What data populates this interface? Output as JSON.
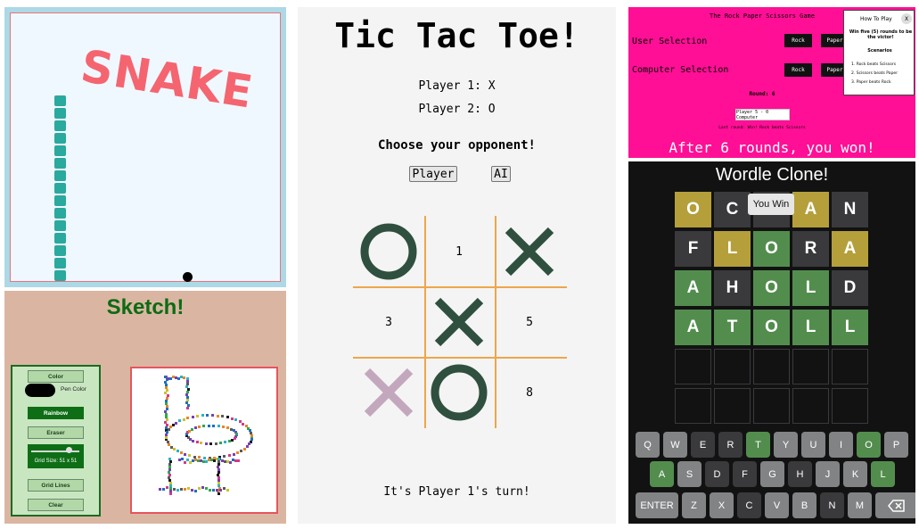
{
  "snake": {
    "title": "SNAKE"
  },
  "sketch": {
    "title": "Sketch!",
    "color_label": "Color",
    "pen_color_label": "Pen Color",
    "rainbow_label": "Rainbow",
    "eraser_label": "Eraser",
    "grid_size": "Grid Size: 51 x 51",
    "grid_lines_label": "Grid Lines",
    "clear_label": "Clear"
  },
  "ttt": {
    "title": "Tic Tac Toe!",
    "player1": "Player 1: X",
    "player2": "Player 2: O",
    "choose": "Choose your opponent!",
    "btn_player": "Player",
    "btn_ai": "AI",
    "cells": [
      "O",
      "1",
      "X",
      "3",
      "X",
      "5",
      "X",
      "O",
      "8"
    ],
    "status": "It's Player 1's turn!",
    "colors": {
      "mark": "#2f4f3f",
      "faded_x": "#c3a8bd",
      "grid": "#eea64a"
    }
  },
  "rps": {
    "title": "The Rock Paper Scissors Game",
    "user_label": "User Selection",
    "computer_label": "Computer Selection",
    "rock": "Rock",
    "paper": "Paper",
    "round": "Round: 6",
    "result": "Player 5 - 0 Computer",
    "history": "Last round: Win! Rock beats Scissors",
    "final": "After 6 rounds, you won!",
    "help": {
      "title": "How To Play",
      "close": "X",
      "text": "Win five (5) rounds to be the victor!",
      "scenarios": "Scenarios",
      "rules": [
        "1. Rock beats Scissors",
        "2. Scissors beats Paper",
        "3. Paper beats Rock"
      ]
    }
  },
  "wordle": {
    "title": "Wordle Clone!",
    "toast": "You Win",
    "rows": [
      {
        "letters": [
          "O",
          "C",
          "E",
          "A",
          "N"
        ],
        "states": [
          "present",
          "absent",
          "absent",
          "present",
          "absent"
        ]
      },
      {
        "letters": [
          "F",
          "L",
          "O",
          "R",
          "A"
        ],
        "states": [
          "absent",
          "present",
          "correct",
          "absent",
          "present"
        ]
      },
      {
        "letters": [
          "A",
          "H",
          "O",
          "L",
          "D"
        ],
        "states": [
          "correct",
          "absent",
          "correct",
          "correct",
          "absent"
        ]
      },
      {
        "letters": [
          "A",
          "T",
          "O",
          "L",
          "L"
        ],
        "states": [
          "correct",
          "correct",
          "correct",
          "correct",
          "correct"
        ]
      },
      {
        "letters": [
          "",
          "",
          "",
          "",
          ""
        ],
        "states": [
          "empty",
          "empty",
          "empty",
          "empty",
          "empty"
        ]
      },
      {
        "letters": [
          "",
          "",
          "",
          "",
          ""
        ],
        "states": [
          "empty",
          "empty",
          "empty",
          "empty",
          "empty"
        ]
      }
    ],
    "keyboard": [
      [
        [
          "Q",
          "used"
        ],
        [
          "W",
          "used"
        ],
        [
          "E",
          "absent"
        ],
        [
          "R",
          "absent"
        ],
        [
          "T",
          "correct"
        ],
        [
          "Y",
          "used"
        ],
        [
          "U",
          "used"
        ],
        [
          "I",
          "used"
        ],
        [
          "O",
          "correct"
        ],
        [
          "P",
          "used"
        ]
      ],
      [
        [
          "A",
          "correct"
        ],
        [
          "S",
          "used"
        ],
        [
          "D",
          "absent"
        ],
        [
          "F",
          "absent"
        ],
        [
          "G",
          "used"
        ],
        [
          "H",
          "absent"
        ],
        [
          "J",
          "used"
        ],
        [
          "K",
          "used"
        ],
        [
          "L",
          "correct"
        ]
      ],
      [
        [
          "ENTER",
          "used"
        ],
        [
          "Z",
          "used"
        ],
        [
          "X",
          "used"
        ],
        [
          "C",
          "absent"
        ],
        [
          "V",
          "used"
        ],
        [
          "B",
          "used"
        ],
        [
          "N",
          "absent"
        ],
        [
          "M",
          "used"
        ],
        [
          "backspace-icon",
          "used"
        ]
      ]
    ],
    "colors": {
      "correct": "#538d4e",
      "present": "#b59f3b",
      "absent": "#3a3a3c",
      "used": "#818384",
      "key_absent": "#3a3a3c"
    }
  }
}
